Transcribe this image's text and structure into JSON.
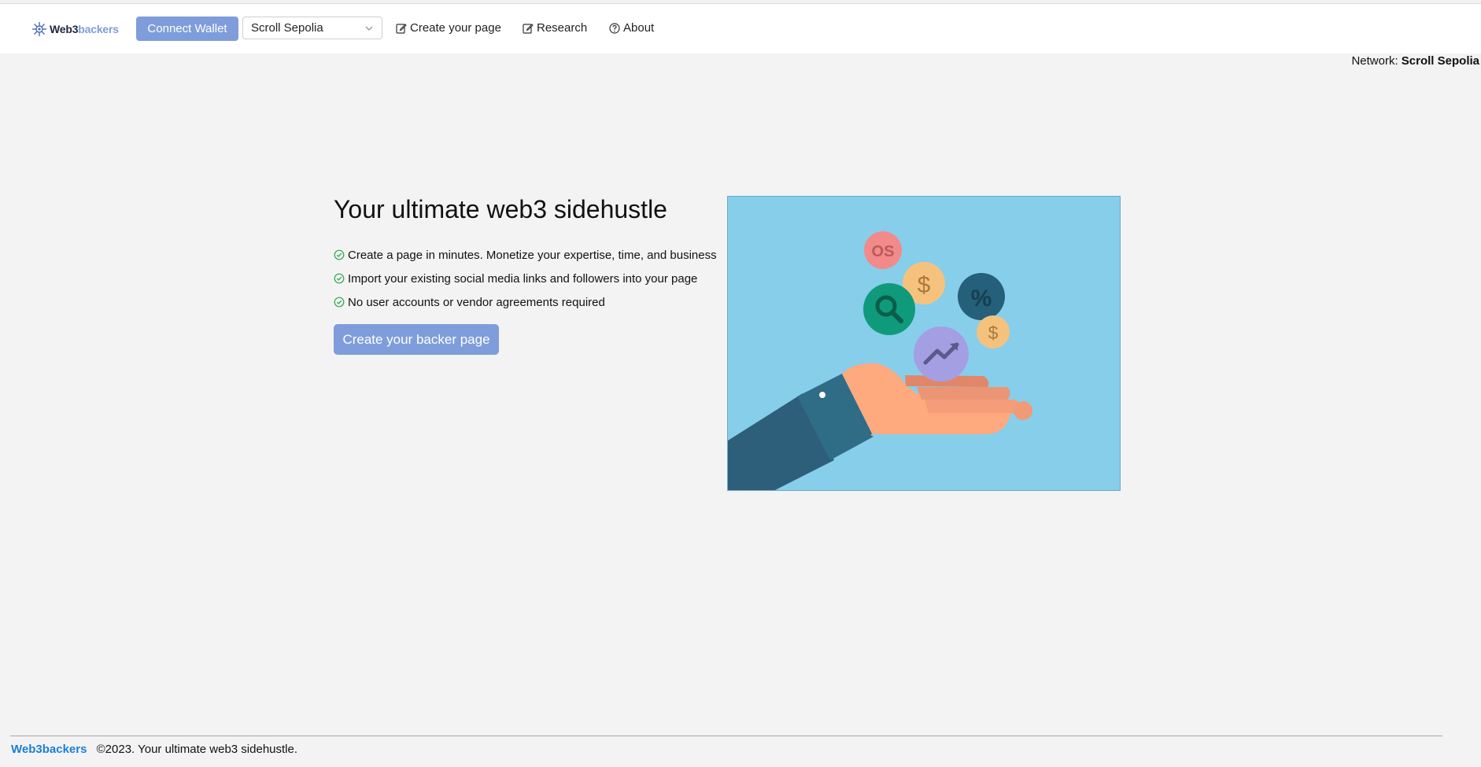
{
  "brand": {
    "part1": "Web3",
    "part2": "backers"
  },
  "nav": {
    "connect_label": "Connect Wallet",
    "network_selected": "Scroll Sepolia",
    "links": [
      {
        "label": "Create your page",
        "icon": "edit-icon"
      },
      {
        "label": "Research",
        "icon": "edit-icon"
      },
      {
        "label": "About",
        "icon": "question-circle-icon"
      }
    ]
  },
  "network_readout": {
    "label": "Network:",
    "value": "Scroll Sepolia"
  },
  "hero": {
    "title": "Your ultimate web3 sidehustle",
    "features": [
      "Create a page in minutes. Monetize your expertise, time, and business",
      "Import your existing social media links and followers into your page",
      "No user accounts or vendor agreements required"
    ],
    "cta_label": "Create your backer page",
    "illustration": {
      "coins": [
        "OS",
        "$",
        "%",
        "$"
      ]
    }
  },
  "footer": {
    "brand": "Web3backers",
    "copyright": "©2023. Your ultimate web3 sidehustle."
  },
  "colors": {
    "accent": "#7f9dda",
    "footer_brand": "#1b7fd6",
    "background": "#f3f3f3",
    "illustration_bg": "#87ceeb",
    "check": "#2ea44f"
  }
}
